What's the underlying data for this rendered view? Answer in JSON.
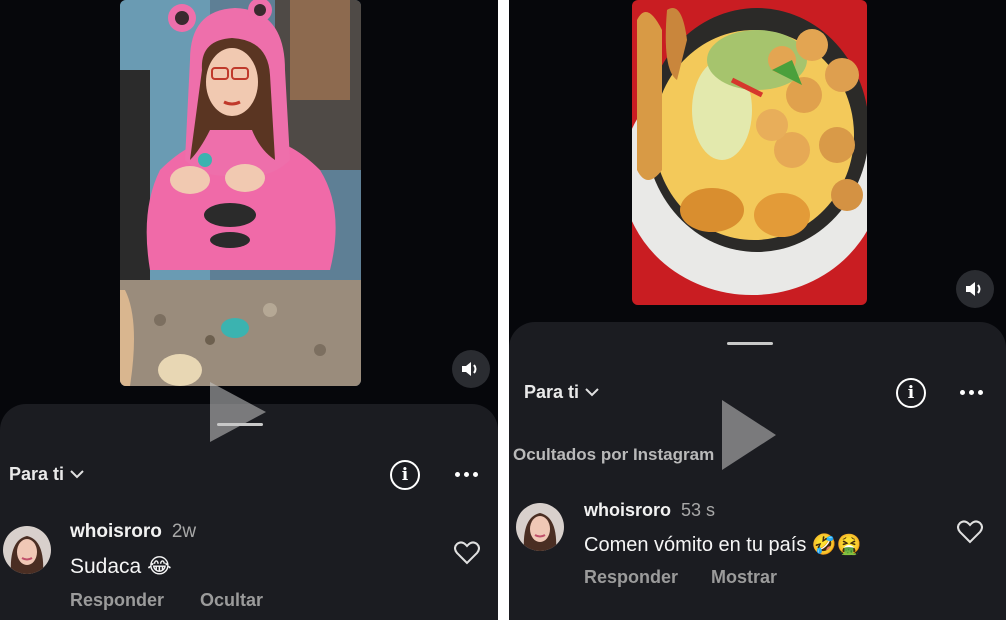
{
  "left": {
    "feed_label": "Para ti",
    "comment": {
      "username": "whoisroro",
      "time": "2w",
      "text": "Sudaca",
      "emoji": "😂",
      "reply_label": "Responder",
      "hide_label": "Ocultar"
    }
  },
  "right": {
    "feed_label": "Para ti",
    "hidden_label": "Ocultados por Instagram",
    "comment": {
      "username": "whoisroro",
      "time": "53 s",
      "text": "Comen vómito en tu país",
      "emoji": "🤣🤮",
      "reply_label": "Responder",
      "show_label": "Mostrar"
    }
  },
  "icons": {
    "info": "info-icon",
    "more": "more-options-icon",
    "heart": "heart-icon",
    "sound": "speaker-icon",
    "play": "play-icon",
    "chevron": "chevron-down-icon"
  },
  "colors": {
    "background": "#06070b",
    "sheet": "#1b1c21",
    "hoodie_pink": "#f06aa8"
  }
}
